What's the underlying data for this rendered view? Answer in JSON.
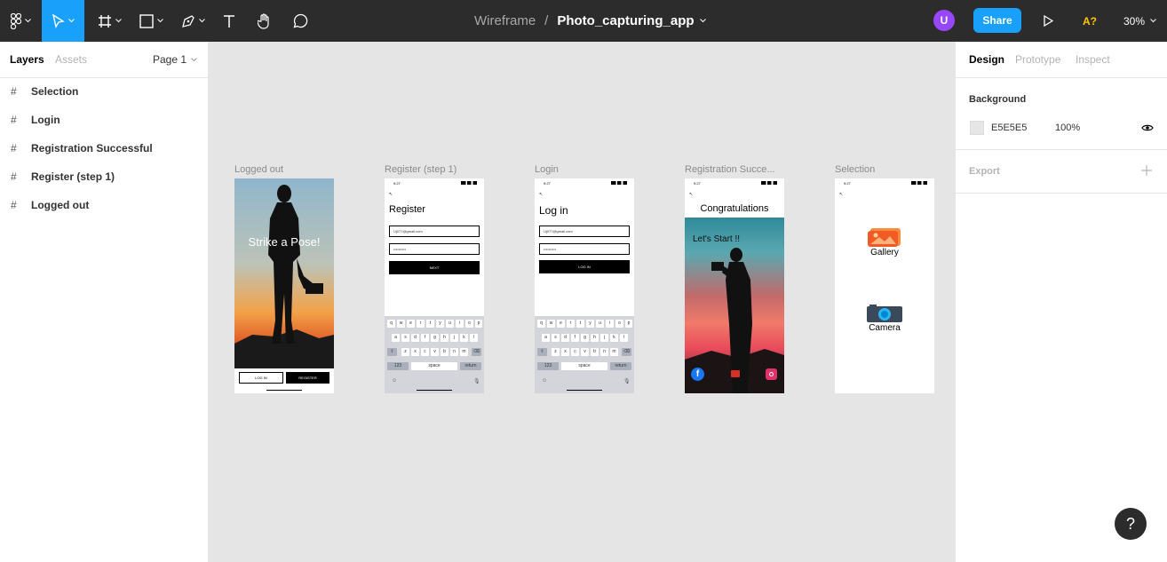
{
  "toolbar": {
    "breadcrumb_team": "Wireframe",
    "breadcrumb_sep": "/",
    "file_name": "Photo_capturing_app",
    "avatar_initial": "U",
    "share_label": "Share",
    "font_warning": "A?",
    "zoom": "30%",
    "accent": "#18a0fb",
    "tools": [
      "figma-menu-icon",
      "move-icon",
      "frame-icon",
      "rectangle-icon",
      "pen-icon",
      "text-icon",
      "hand-icon",
      "comment-icon"
    ]
  },
  "left_panel": {
    "tabs": [
      "Layers",
      "Assets"
    ],
    "page": "Page 1",
    "layers": [
      "Selection",
      "Login",
      "Registration Successful",
      "Register (step 1)",
      "Logged out"
    ]
  },
  "canvas": {
    "frames": [
      {
        "label": "Logged out",
        "hero_text": "Strike a Pose!",
        "login_btn": "LOG IN",
        "register_btn": "REGISTER"
      },
      {
        "label": "Register (step 1)",
        "time": "9:27",
        "back": "↖",
        "title": "Register",
        "email": "Uj077@gmail.com",
        "password": "••••••••••",
        "button": "NEXT"
      },
      {
        "label": "Login",
        "time": "9:27",
        "back": "↖",
        "title": "Log in",
        "email": "Uj077@gmail.com",
        "password": "••••••••••",
        "button": "LOG IN"
      },
      {
        "label": "Registration Succe...",
        "time": "9:27",
        "back": "↖",
        "title": "Congratulations",
        "subtitle": "Let's Start !!"
      },
      {
        "label": "Selection",
        "time": "9:27",
        "back": "↖",
        "gallery": "Gallery",
        "camera": "Camera"
      }
    ],
    "keyboard": {
      "row1": [
        "q",
        "w",
        "e",
        "r",
        "t",
        "y",
        "u",
        "i",
        "o",
        "p"
      ],
      "row2": [
        "a",
        "s",
        "d",
        "f",
        "g",
        "h",
        "j",
        "k",
        "l"
      ],
      "row3": [
        "z",
        "x",
        "c",
        "v",
        "b",
        "n",
        "m"
      ],
      "num": "123",
      "space": "space",
      "return": "return"
    }
  },
  "right_panel": {
    "tabs": [
      "Design",
      "Prototype",
      "Inspect"
    ],
    "background_title": "Background",
    "background_hex": "E5E5E5",
    "background_opacity": "100%",
    "export_title": "Export"
  },
  "help": "?"
}
